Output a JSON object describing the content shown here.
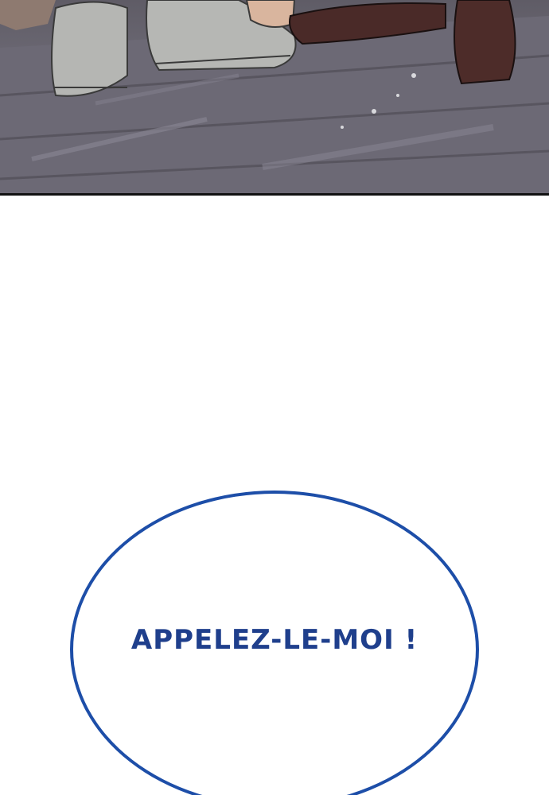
{
  "comic": {
    "speech_bubble": {
      "text": "APPELEZ-LE-MOI !",
      "text_color": "#1f3f8c",
      "border_color": "#1d4ea8"
    },
    "panel_top": {
      "colors": {
        "floor": "#6e6b76",
        "sneaker": "#b5b6b3",
        "dress_shoe": "#4a2a28"
      }
    }
  }
}
